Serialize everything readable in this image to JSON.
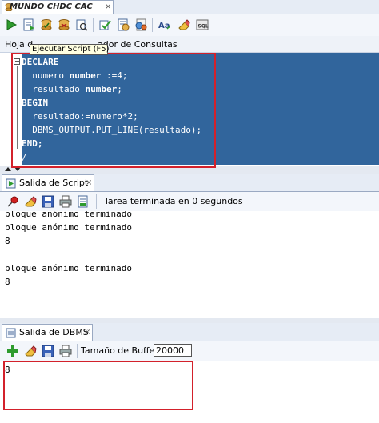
{
  "document_tab": {
    "title": "MUNDO CHDC CAC",
    "close": "×"
  },
  "toolbar": {
    "tooltip": "Ejecutar Script (F5)",
    "icons": [
      "run-statement-icon",
      "run-script-icon",
      "commit-icon",
      "rollback-icon",
      "explain-plan-icon",
      "autotrace-icon",
      "sql-history-icon",
      "format-icon",
      "clear-icon",
      "sql-tuning-icon"
    ]
  },
  "subtabs": {
    "worksheet": "Hoja de Trabajo",
    "query_builder": "Generador de Consultas",
    "worksheet_visible_prefix": "Hoja d",
    "query_builder_visible_suffix": "ador de Consultas"
  },
  "editor": {
    "lines": [
      [
        "DECLARE"
      ],
      [
        "  numero ",
        "number",
        " :=4;"
      ],
      [
        "  resultado ",
        "number",
        ";"
      ],
      [
        "BEGIN"
      ],
      [
        "  resultado:=numero*2;"
      ],
      [
        "  DBMS_OUTPUT.PUT_LINE(resultado);"
      ],
      [
        "END;"
      ],
      [
        "/"
      ]
    ]
  },
  "script_output": {
    "tab_label": "Salida de Script",
    "status": "Tarea terminada en 0 segundos",
    "lines": [
      "bloque anónimo terminado",
      "bloque anónimo terminado",
      "8",
      "",
      "bloque anónimo terminado",
      "8"
    ]
  },
  "dbms_output": {
    "tab_label": "Salida de DBMS",
    "buffer_label": "Tamaño de Buffer:",
    "buffer_value": "20000",
    "lines": [
      "8"
    ]
  },
  "colors": {
    "selection": "#31659c",
    "highlight_box": "#d3212b",
    "tooltip_bg": "#ffffe1"
  }
}
